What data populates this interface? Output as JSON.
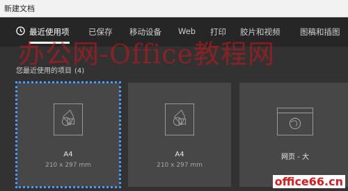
{
  "window": {
    "title": "新建文档"
  },
  "tabs": [
    {
      "label": "最近使用项",
      "active": true,
      "icon": "clock-icon"
    },
    {
      "label": "已保存"
    },
    {
      "label": "移动设备"
    },
    {
      "label": "Web"
    },
    {
      "label": "打印"
    },
    {
      "label": "胶片和视频"
    },
    {
      "label": "图稿和插图"
    }
  ],
  "recent": {
    "title": "您最近使用的项目",
    "count": "(4)",
    "items": [
      {
        "name": "A4",
        "size": "210 x 297 mm",
        "icon": "art-document-icon",
        "selected": true
      },
      {
        "name": "A4",
        "size": "210 x 297 mm",
        "icon": "art-document-icon"
      },
      {
        "name": "网页 - 大",
        "size": "",
        "icon": "web-globe-icon"
      }
    ]
  },
  "watermark": {
    "text": "办公网-Office教程网"
  },
  "brand": {
    "text": "office66.cn"
  },
  "colors": {
    "accent": "#4b9cff",
    "watermark": "#d3141a",
    "background": "#323232"
  }
}
